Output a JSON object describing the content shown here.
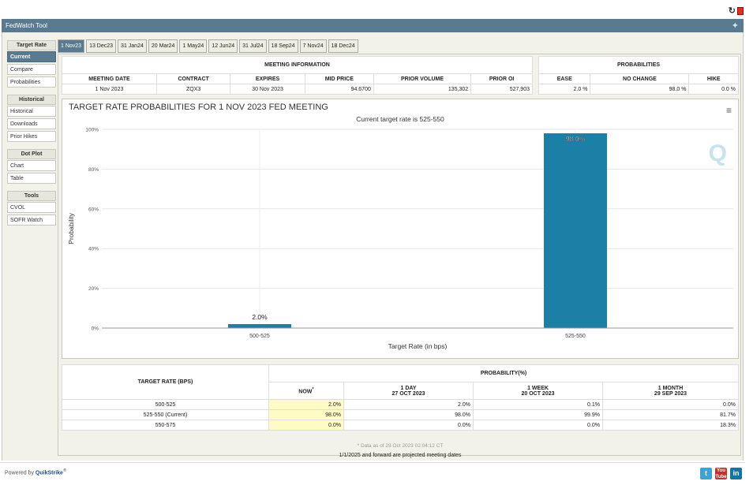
{
  "app_title": "FedWatch Tool",
  "sidebar": {
    "target_rate": {
      "label": "Target Rate",
      "items": [
        "Current",
        "Compare",
        "Probabilities"
      ]
    },
    "historical": {
      "label": "Historical",
      "items": [
        "Historical",
        "Downloads",
        "Prior Hikes"
      ]
    },
    "dot_plot": {
      "label": "Dot Plot",
      "items": [
        "Chart",
        "Table"
      ]
    },
    "tools": {
      "label": "Tools",
      "items": [
        "CVOL",
        "SOFR Watch"
      ]
    }
  },
  "tabs": [
    "1 Nov23",
    "13 Dec23",
    "31 Jan24",
    "20 Mar24",
    "1 May24",
    "12 Jun24",
    "31 Jul24",
    "18 Sep24",
    "7 Nov24",
    "18 Dec24"
  ],
  "meeting_info": {
    "title": "MEETING INFORMATION",
    "columns": [
      "MEETING DATE",
      "CONTRACT",
      "EXPIRES",
      "MID PRICE",
      "PRIOR VOLUME",
      "PRIOR OI"
    ],
    "row": [
      "1 Nov 2023",
      "ZQX3",
      "30 Nov 2023",
      "94.6700",
      "135,302",
      "527,903"
    ]
  },
  "probabilities": {
    "title": "PROBABILITIES",
    "columns": [
      "EASE",
      "NO CHANGE",
      "HIKE"
    ],
    "row": [
      "2.0 %",
      "98.0 %",
      "0.0 %"
    ]
  },
  "chart_title": "TARGET RATE PROBABILITIES FOR 1 NOV 2023 FED MEETING",
  "chart_subtitle": "Current target rate is 525-550",
  "chart_data": {
    "type": "bar",
    "categories": [
      "500-525",
      "525-550"
    ],
    "values": [
      2.0,
      98.0
    ],
    "data_labels": [
      "2.0%",
      "98.0%"
    ],
    "xlabel": "Target Rate (in bps)",
    "ylabel": "Probability",
    "ylim": [
      0,
      100
    ],
    "yticks": [
      "0%",
      "20%",
      "40%",
      "60%",
      "80%",
      "100%"
    ],
    "bar_color": "#1c7fa6"
  },
  "bottom_table": {
    "col_target": "TARGET RATE (BPS)",
    "col_prob": "PROBABILITY(%)",
    "sub_cols": [
      {
        "l1": "NOW",
        "l2": ""
      },
      {
        "l1": "1 DAY",
        "l2": "27 OCT 2023"
      },
      {
        "l1": "1 WEEK",
        "l2": "20 OCT 2023"
      },
      {
        "l1": "1 MONTH",
        "l2": "29 SEP 2023"
      }
    ],
    "rows": [
      [
        "500-525",
        "2.0%",
        "2.0%",
        "0.1%",
        "0.0%"
      ],
      [
        "525-550 (Current)",
        "98.0%",
        "98.0%",
        "99.9%",
        "81.7%"
      ],
      [
        "550-575",
        "0.0%",
        "0.0%",
        "0.0%",
        "18.3%"
      ]
    ]
  },
  "data_note": "* Data as of 29 Oct 2023 02:04:12 CT",
  "projected_note": "1/1/2025 and forward are projected meeting dates",
  "footer": {
    "powered": "Powered by",
    "brand": "QuikStrike"
  }
}
